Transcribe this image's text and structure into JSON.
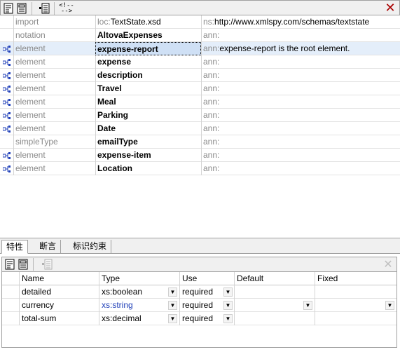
{
  "colors": {
    "close": "#a80000",
    "selected_row": "#e4eefa",
    "prefix_gray": "#8a8a8a",
    "type_blue": "#1f3fb8"
  },
  "toolbar": {
    "icons": [
      "append-row-icon",
      "insert-row-icon",
      "add-child-icon",
      "comment-icon",
      "close-icon"
    ],
    "comment_glyph_top": "<!--",
    "comment_glyph_bottom": "-->",
    "close_glyph": "✕"
  },
  "grid": {
    "rows": [
      {
        "icon": "",
        "kind": "import",
        "name_prefix": "loc:",
        "name": "TextState.xsd",
        "ann_prefix": "ns:",
        "ann": "http://www.xmlspy.com/schemas/textstate",
        "bold": false
      },
      {
        "icon": "",
        "kind": "notation",
        "name_prefix": "",
        "name": "AltovaExpenses",
        "ann_prefix": "ann:",
        "ann": "",
        "bold": true
      },
      {
        "icon": "element-icon",
        "kind": "element",
        "name_prefix": "",
        "name": "expense-report",
        "ann_prefix": "ann:",
        "ann": "expense-report is the root element.",
        "bold": true
      },
      {
        "icon": "element-icon",
        "kind": "element",
        "name_prefix": "",
        "name": "expense",
        "ann_prefix": "ann:",
        "ann": "",
        "bold": true
      },
      {
        "icon": "element-icon",
        "kind": "element",
        "name_prefix": "",
        "name": "description",
        "ann_prefix": "ann:",
        "ann": "",
        "bold": true
      },
      {
        "icon": "element-icon",
        "kind": "element",
        "name_prefix": "",
        "name": "Travel",
        "ann_prefix": "ann:",
        "ann": "",
        "bold": true
      },
      {
        "icon": "element-icon",
        "kind": "element",
        "name_prefix": "",
        "name": "Meal",
        "ann_prefix": "ann:",
        "ann": "",
        "bold": true
      },
      {
        "icon": "element-icon",
        "kind": "element",
        "name_prefix": "",
        "name": "Parking",
        "ann_prefix": "ann:",
        "ann": "",
        "bold": true
      },
      {
        "icon": "element-icon",
        "kind": "element",
        "name_prefix": "",
        "name": "Date",
        "ann_prefix": "ann:",
        "ann": "",
        "bold": true
      },
      {
        "icon": "",
        "kind": "simpleType",
        "name_prefix": "",
        "name": "emailType",
        "ann_prefix": "ann:",
        "ann": "",
        "bold": true
      },
      {
        "icon": "element-icon",
        "kind": "element",
        "name_prefix": "",
        "name": "expense-item",
        "ann_prefix": "ann:",
        "ann": "",
        "bold": true
      },
      {
        "icon": "element-icon",
        "kind": "element",
        "name_prefix": "",
        "name": "Location",
        "ann_prefix": "ann:",
        "ann": "",
        "bold": true
      }
    ]
  },
  "tabs": [
    {
      "label": "特性",
      "active": true
    },
    {
      "label": "断言",
      "active": false
    },
    {
      "label": "标识约束",
      "active": false
    }
  ],
  "attributes": {
    "columns": [
      "Name",
      "Type",
      "Use",
      "Default",
      "Fixed"
    ],
    "rows": [
      {
        "name": "detailed",
        "type": "xs:boolean",
        "use": "required",
        "default": "",
        "fixed": "",
        "type_blue": false,
        "has_default_dd": false
      },
      {
        "name": "currency",
        "type": "xs:string",
        "use": "required",
        "default": "",
        "fixed": "",
        "type_blue": true,
        "has_default_dd": true
      },
      {
        "name": "total-sum",
        "type": "xs:decimal",
        "use": "required",
        "default": "",
        "fixed": "",
        "type_blue": false,
        "has_default_dd": false
      }
    ],
    "dropdown_glyph": "▼"
  }
}
